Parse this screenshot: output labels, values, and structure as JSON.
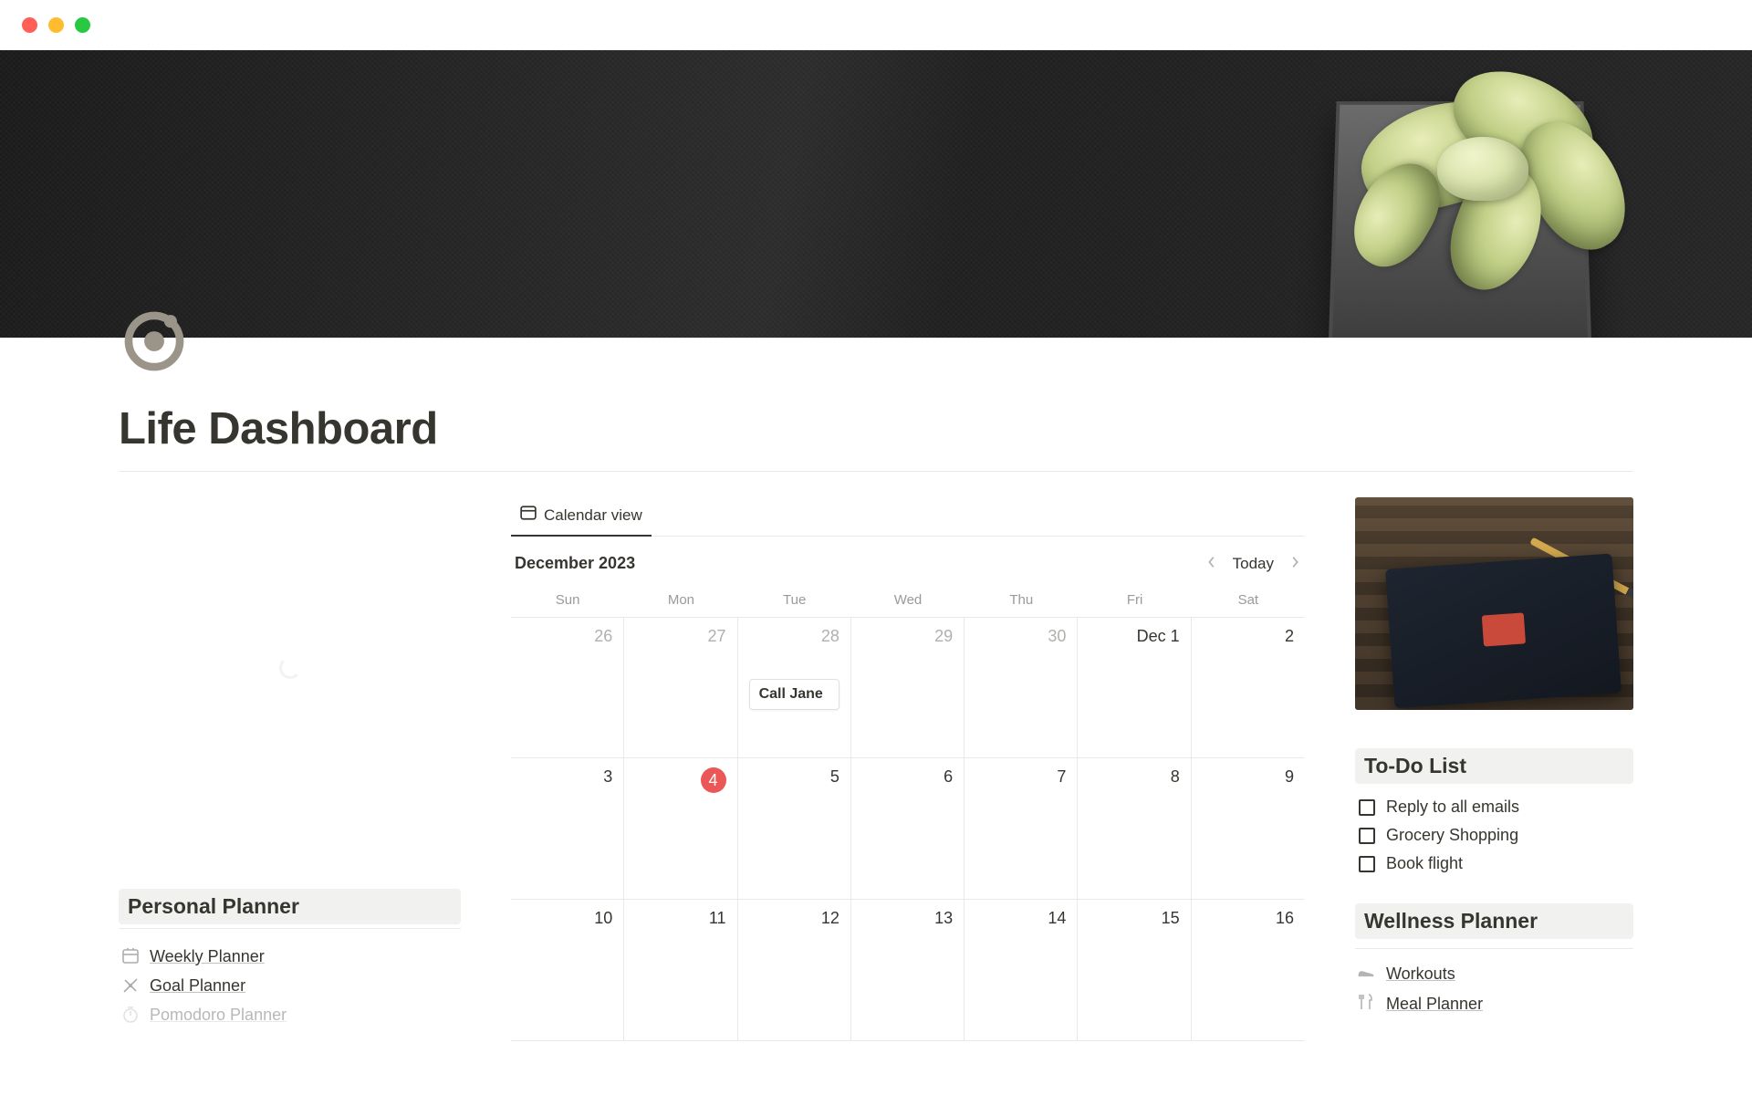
{
  "page": {
    "title": "Life Dashboard"
  },
  "calendar": {
    "view_label": "Calendar view",
    "month_label": "December 2023",
    "today_label": "Today",
    "days_of_week": [
      "Sun",
      "Mon",
      "Tue",
      "Wed",
      "Thu",
      "Fri",
      "Sat"
    ],
    "weeks": [
      [
        {
          "num": "26",
          "muted": true
        },
        {
          "num": "27",
          "muted": true
        },
        {
          "num": "28",
          "muted": true,
          "event": "Call Jane"
        },
        {
          "num": "29",
          "muted": true
        },
        {
          "num": "30",
          "muted": true
        },
        {
          "num": "Dec 1",
          "muted": false,
          "label": true
        },
        {
          "num": "2",
          "muted": false
        }
      ],
      [
        {
          "num": "3"
        },
        {
          "num": "4",
          "today": true
        },
        {
          "num": "5"
        },
        {
          "num": "6"
        },
        {
          "num": "7"
        },
        {
          "num": "8"
        },
        {
          "num": "9"
        }
      ],
      [
        {
          "num": "10"
        },
        {
          "num": "11"
        },
        {
          "num": "12"
        },
        {
          "num": "13"
        },
        {
          "num": "14"
        },
        {
          "num": "15"
        },
        {
          "num": "16"
        }
      ]
    ]
  },
  "left": {
    "heading": "Personal Planner",
    "links": [
      {
        "icon": "calendar-week-icon",
        "label": "Weekly Planner"
      },
      {
        "icon": "target-icon",
        "label": "Goal Planner"
      },
      {
        "icon": "timer-icon",
        "label": "Pomodoro Planner"
      }
    ]
  },
  "right": {
    "todo_heading": "To-Do List",
    "todos": [
      {
        "label": "Reply to all emails",
        "checked": false
      },
      {
        "label": "Grocery Shopping",
        "checked": false
      },
      {
        "label": "Book flight",
        "checked": false
      }
    ],
    "wellness_heading": "Wellness Planner",
    "wellness_links": [
      {
        "icon": "shoe-icon",
        "label": "Workouts"
      },
      {
        "icon": "utensils-icon",
        "label": "Meal Planner"
      }
    ]
  }
}
